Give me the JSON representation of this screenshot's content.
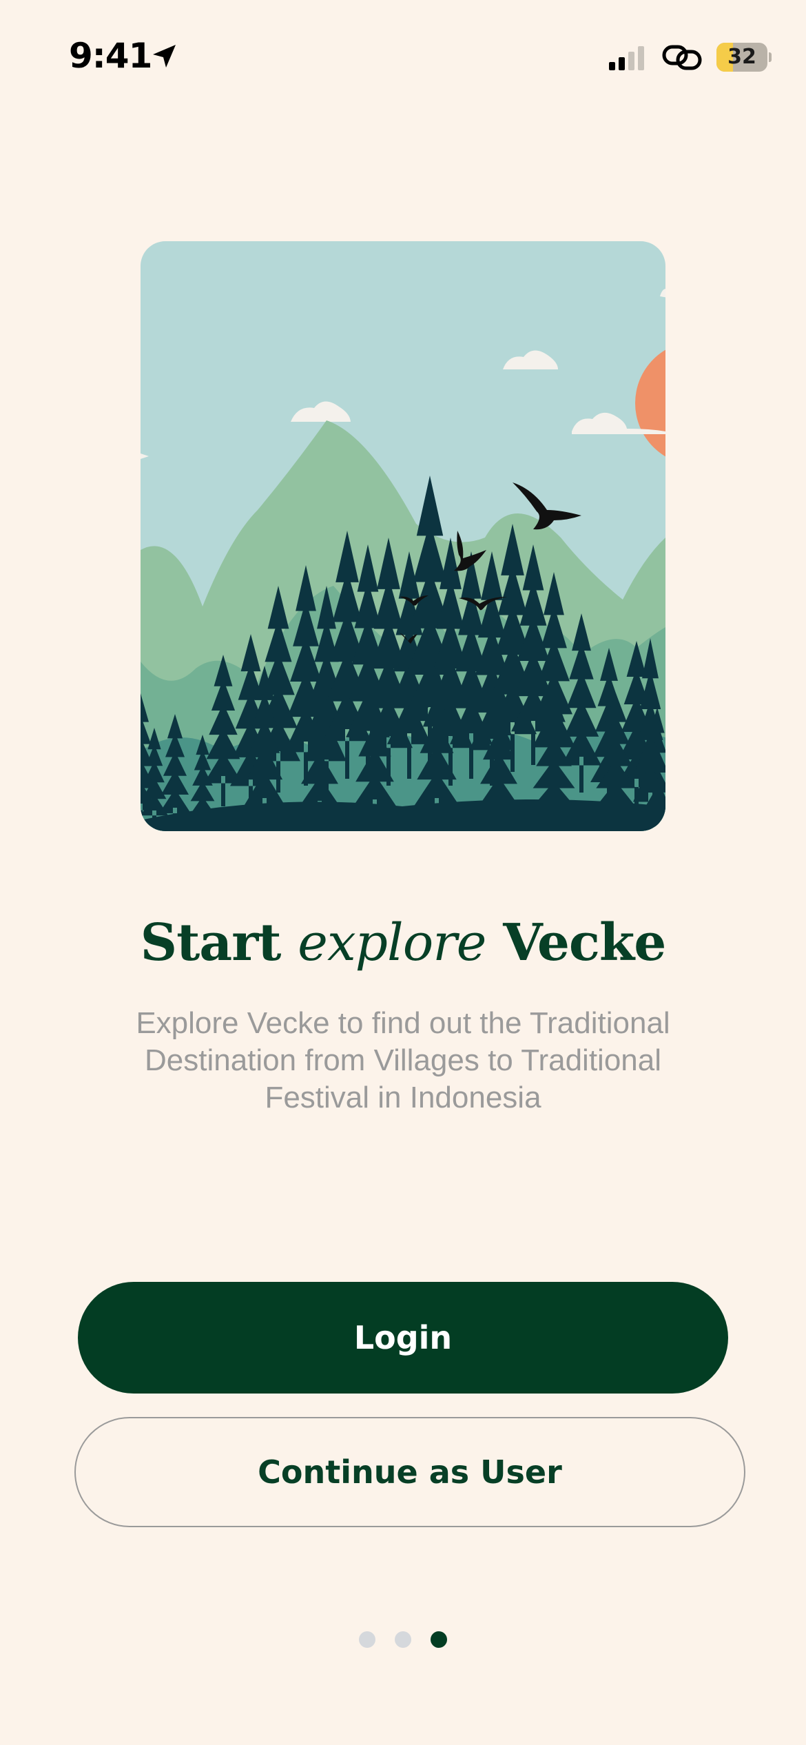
{
  "status_bar": {
    "time": "9:41",
    "battery_level": "32",
    "battery_fraction": 0.32,
    "icons": [
      "location-arrow-icon",
      "cellular-signal-icon",
      "personal-hotspot-link-icon",
      "battery-icon"
    ]
  },
  "hero": {
    "illustration": "mountain-forest-birds-illustration",
    "colors": {
      "sky": "#b5d8d7",
      "sun": "#ef9168",
      "cloud": "#f4f1ec",
      "mountain_light": "#92c2a0",
      "mountain_mid": "#73b194",
      "mountain_dark": "#4b9588",
      "forest": "#0c3440",
      "bird": "#111111"
    }
  },
  "onboarding": {
    "title_start": "Start",
    "title_accent": "explore",
    "title_end": "Vecke",
    "description": "Explore Vecke to find out the Traditional Destination from Villages to Traditional Festival in Indonesia"
  },
  "actions": {
    "login_label": "Login",
    "guest_label": "Continue as User"
  },
  "pagination": {
    "total_pages": 3,
    "current_page": 3
  },
  "colors": {
    "background": "#fcf3ea",
    "primary": "#033d23",
    "title_text": "#073f26",
    "body_text": "#9a9a9a",
    "dot_inactive": "#d5d8dc",
    "dot_active": "#033d23"
  }
}
